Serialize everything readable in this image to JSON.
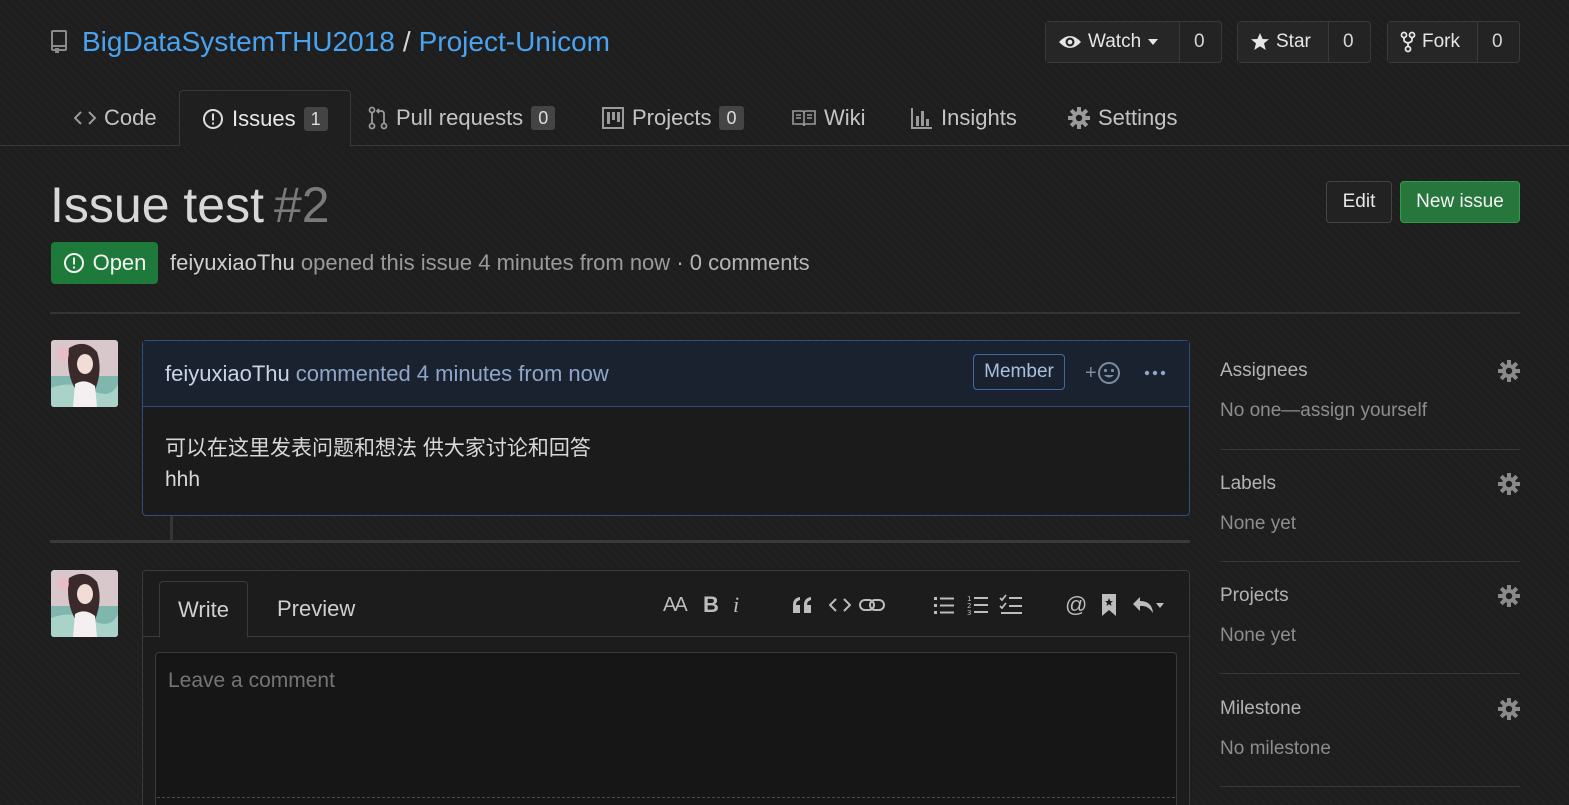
{
  "repo": {
    "owner": "BigDataSystemTHU2018",
    "separator": "/",
    "name": "Project-Unicom"
  },
  "actions": {
    "watch": {
      "label": "Watch",
      "count": "0"
    },
    "star": {
      "label": "Star",
      "count": "0"
    },
    "fork": {
      "label": "Fork",
      "count": "0"
    }
  },
  "tabs": [
    {
      "label": "Code",
      "icon": "code-icon"
    },
    {
      "label": "Issues",
      "icon": "issue-opened-icon",
      "badge": "1",
      "selected": true
    },
    {
      "label": "Pull requests",
      "icon": "git-pull-request-icon",
      "badge": "0"
    },
    {
      "label": "Projects",
      "icon": "project-icon",
      "badge": "0"
    },
    {
      "label": "Wiki",
      "icon": "book-icon"
    },
    {
      "label": "Insights",
      "icon": "graph-icon"
    },
    {
      "label": "Settings",
      "icon": "gear-icon"
    }
  ],
  "issue": {
    "title": "Issue test",
    "number": "#2",
    "state": "Open",
    "author": "feiyuxiaoThu",
    "opened_text": "opened this issue 4 minutes from now",
    "comment_count": "· 0 comments",
    "edit_label": "Edit",
    "new_issue_label": "New issue"
  },
  "comment": {
    "author": "feiyuxiaoThu",
    "action": "commented 4 minutes from now",
    "role": "Member",
    "body_line1": "可以在这里发表问题和想法 供大家讨论和回答",
    "body_line2": "hhh"
  },
  "form": {
    "write_tab": "Write",
    "preview_tab": "Preview",
    "placeholder": "Leave a comment",
    "toolbar": {
      "header": "AA",
      "bold": "B",
      "italic": "i",
      "mention": "@"
    }
  },
  "sidebar": {
    "assignees": {
      "heading": "Assignees",
      "value": "No one—assign yourself"
    },
    "labels": {
      "heading": "Labels",
      "value": "None yet"
    },
    "projects": {
      "heading": "Projects",
      "value": "None yet"
    },
    "milestone": {
      "heading": "Milestone",
      "value": "No milestone"
    }
  },
  "colors": {
    "link": "#4aa3f0",
    "open_green": "#1e7a3a",
    "new_issue_green": "#27763b",
    "comment_border": "#2f4f7a",
    "background": "#1e1e1e"
  }
}
